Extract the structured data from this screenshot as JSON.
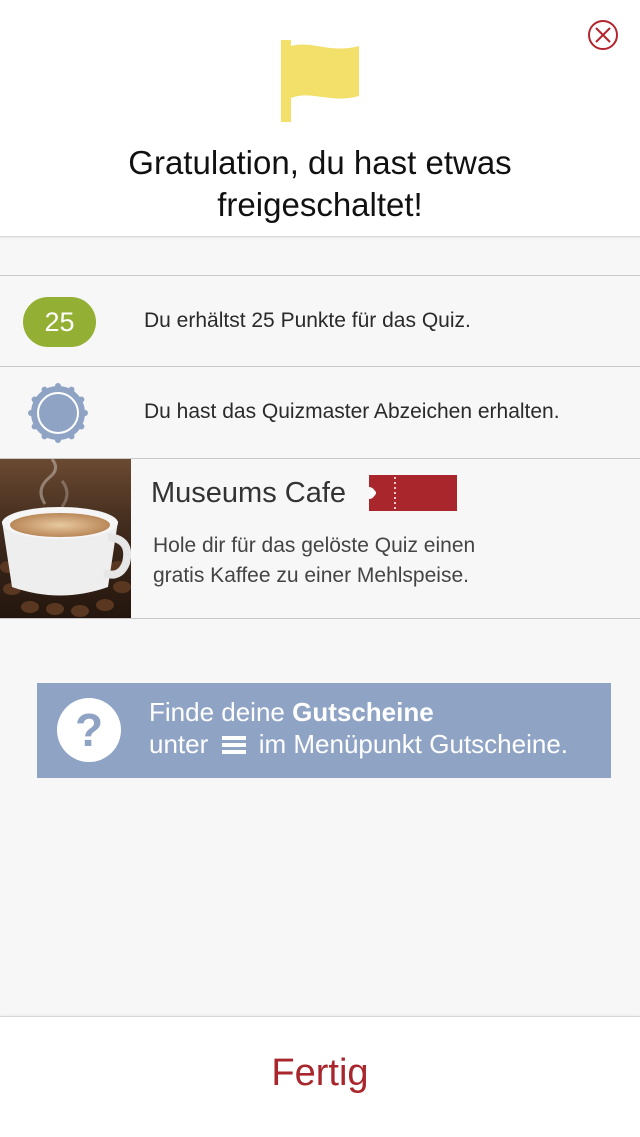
{
  "header": {
    "title_line1": "Gratulation, du hast etwas",
    "title_line2": "freigeschaltet!",
    "flag_color": "#f2e06b",
    "close_color": "#b3262e"
  },
  "rewards": {
    "points_value": "25",
    "points_text": "Du erhältst 25 Punkte für das Quiz.",
    "points_color": "#94b034",
    "badge_text": "Du hast das Quizmaster Abzeichen erhalten.",
    "badge_color": "#8fa3c5"
  },
  "voucher": {
    "name": "Museums Cafe",
    "desc_line1": "Hole dir für das gelöste Quiz einen",
    "desc_line2": "gratis Kaffee zu einer Mehlspeise.",
    "ticket_color": "#a8262c"
  },
  "info": {
    "line1_prefix": "Finde deine ",
    "line1_bold": "Gutscheine",
    "line2_prefix": "unter",
    "line2_suffix": "im Menüpunkt Gutscheine.",
    "help_symbol": "?",
    "color": "#8fa3c5"
  },
  "footer": {
    "done_label": "Fertig"
  }
}
